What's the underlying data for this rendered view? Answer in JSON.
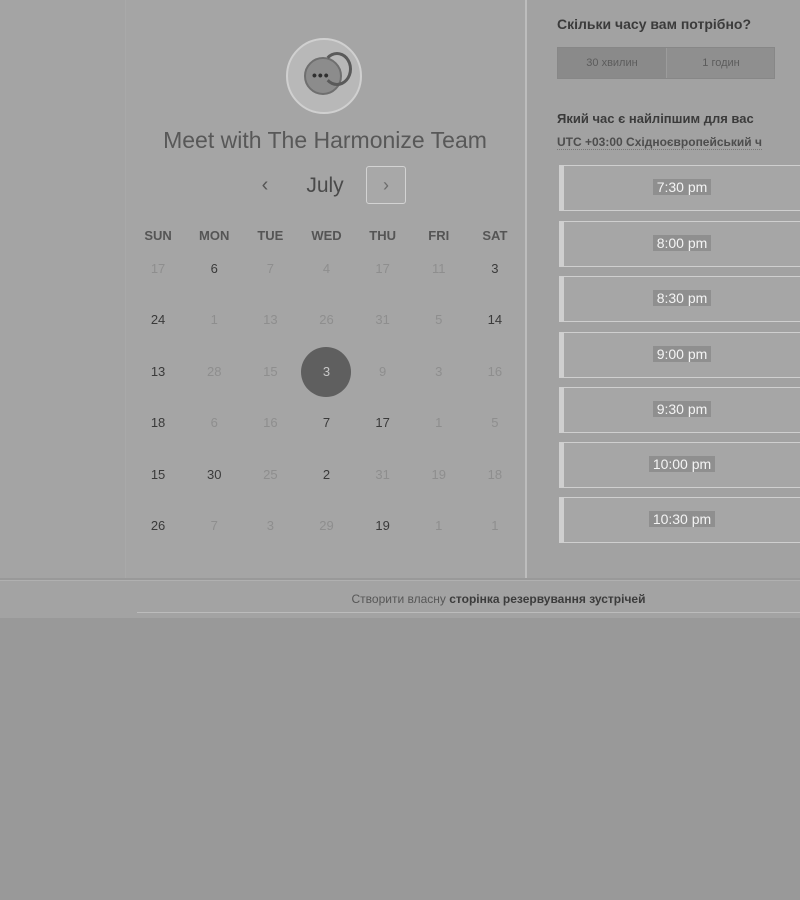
{
  "booking": {
    "title": "Meet with The Harmonize Team",
    "month": "July",
    "prev_arrow": "‹",
    "next_arrow": "›",
    "weekdays": [
      "SUN",
      "MON",
      "TUE",
      "WED",
      "THU",
      "FRI",
      "SAT"
    ],
    "weeks": [
      [
        {
          "d": "17",
          "s": "dim"
        },
        {
          "d": "6",
          "s": "act"
        },
        {
          "d": "7",
          "s": "dim"
        },
        {
          "d": "4",
          "s": "dim"
        },
        {
          "d": "17",
          "s": "dim"
        },
        {
          "d": "11",
          "s": "dim"
        },
        {
          "d": "3",
          "s": "act"
        }
      ],
      [
        {
          "d": "24",
          "s": "act"
        },
        {
          "d": "1",
          "s": "dim"
        },
        {
          "d": "13",
          "s": "dim"
        },
        {
          "d": "26",
          "s": "dim"
        },
        {
          "d": "31",
          "s": "dim"
        },
        {
          "d": "5",
          "s": "dim"
        },
        {
          "d": "14",
          "s": "act"
        }
      ],
      [
        {
          "d": "13",
          "s": "act"
        },
        {
          "d": "28",
          "s": "dim"
        },
        {
          "d": "15",
          "s": "dim"
        },
        {
          "d": "3",
          "s": "sel"
        },
        {
          "d": "9",
          "s": "dim"
        },
        {
          "d": "3",
          "s": "dim"
        },
        {
          "d": "16",
          "s": "dim"
        }
      ],
      [
        {
          "d": "18",
          "s": "act"
        },
        {
          "d": "6",
          "s": "dim"
        },
        {
          "d": "16",
          "s": "dim"
        },
        {
          "d": "7",
          "s": "act"
        },
        {
          "d": "17",
          "s": "act"
        },
        {
          "d": "1",
          "s": "dim"
        },
        {
          "d": "5",
          "s": "dim"
        }
      ],
      [
        {
          "d": "15",
          "s": "act"
        },
        {
          "d": "30",
          "s": "act"
        },
        {
          "d": "25",
          "s": "dim"
        },
        {
          "d": "2",
          "s": "act"
        },
        {
          "d": "31",
          "s": "dim"
        },
        {
          "d": "19",
          "s": "dim"
        },
        {
          "d": "18",
          "s": "dim"
        }
      ],
      [
        {
          "d": "26",
          "s": "act"
        },
        {
          "d": "7",
          "s": "dim"
        },
        {
          "d": "3",
          "s": "dim"
        },
        {
          "d": "29",
          "s": "dim"
        },
        {
          "d": "19",
          "s": "act"
        },
        {
          "d": "1",
          "s": "dim"
        },
        {
          "d": "1",
          "s": "dim"
        }
      ]
    ]
  },
  "duration": {
    "question": "Скільки часу вам потрібно?",
    "options": [
      "30 хвилин",
      "1 годин"
    ],
    "selected": 0
  },
  "times": {
    "question": "Який час є найліпшим для вас",
    "timezone": "UTC +03:00 Східноєвропейський ч",
    "slots": [
      "7:30 pm",
      "8:00 pm",
      "8:30 pm",
      "9:00 pm",
      "9:30 pm",
      "10:00 pm",
      "10:30 pm"
    ]
  },
  "footer": {
    "prefix": "Створити власну",
    "link_bold": "сторінка резервування зустрічей"
  }
}
